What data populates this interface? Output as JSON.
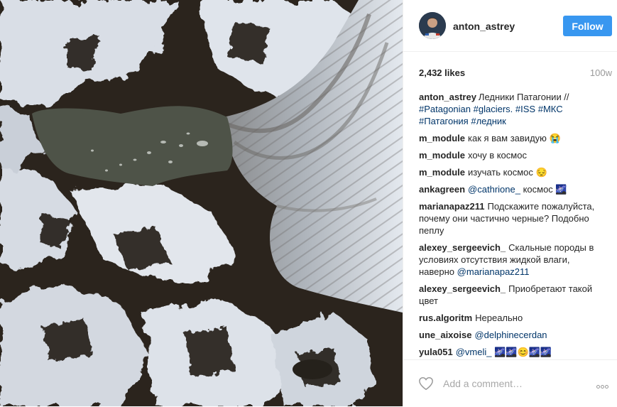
{
  "header": {
    "username": "anton_astrey",
    "follow_label": "Follow",
    "accent": "#3897f0"
  },
  "stats": {
    "likes": "2,432 likes",
    "age": "100w"
  },
  "caption": {
    "author": "anton_astrey",
    "text": "Ледники Патагонии //",
    "tags": [
      "#Patagonian",
      "#glaciers.",
      "#ISS",
      "#МКС",
      "#Патагония",
      "#ледник"
    ]
  },
  "comments": [
    {
      "author": "m_module",
      "text": "как я вам завидую 😭"
    },
    {
      "author": "m_module",
      "text": "хочу в космос"
    },
    {
      "author": "m_module",
      "text": "изучать космос 😔"
    },
    {
      "author": "ankagreen",
      "mention": "@cathrione_",
      "text": "космос 🌌"
    },
    {
      "author": "marianapaz211",
      "text": "Подскажите пожалуйста, почему они частично черные? Подобно пеплу"
    },
    {
      "author": "alexey_sergeevich_",
      "text": "Скальные породы в условиях отсутствия жидкой влаги, наверно",
      "mention": "@marianapaz211"
    },
    {
      "author": "alexey_sergeevich_",
      "text": "Приобретают такой цвет"
    },
    {
      "author": "rus.algoritm",
      "text": "Нереально"
    },
    {
      "author": "une_aixoise",
      "mention": "@delphinecerdan"
    },
    {
      "author": "yula051",
      "mention": "@vmeli_",
      "text": "🌌🌌😊🌌🌌"
    }
  ],
  "add_comment": {
    "placeholder": "Add a comment…"
  },
  "icons": {
    "like": "heart-icon",
    "more": "more-options-icon"
  },
  "colors": {
    "link": "#003569",
    "muted": "#999999",
    "lake": "#4e5348",
    "glacier": "#b9c0c8"
  }
}
